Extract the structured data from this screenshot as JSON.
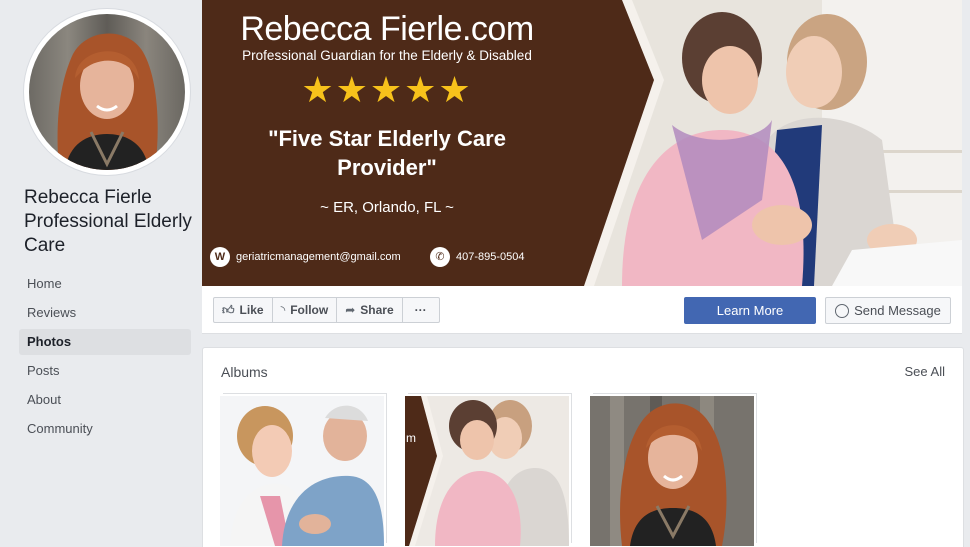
{
  "page": {
    "name": "Rebecca Fierle\nProfessional Elderly\nCare"
  },
  "nav": {
    "items": [
      {
        "label": "Home",
        "active": false
      },
      {
        "label": "Reviews",
        "active": false
      },
      {
        "label": "Photos",
        "active": true
      },
      {
        "label": "Posts",
        "active": false
      },
      {
        "label": "About",
        "active": false
      },
      {
        "label": "Community",
        "active": false
      }
    ]
  },
  "cover": {
    "title": "Rebecca Fierle.com",
    "subtitle": "Professional Guardian for the Elderly & Disabled",
    "stars": "★★★★★",
    "quote": "\"Five Star Elderly Care Provider\"",
    "location": "~ ER, Orlando, FL ~",
    "email": "geriatricmanagement@gmail.com",
    "phone": "407-895-0504",
    "colors": {
      "brown": "#4e2a18",
      "star": "#f7c21b"
    }
  },
  "actions": {
    "like": "Like",
    "follow": "Follow",
    "share": "Share",
    "more": "···",
    "learn_more": "Learn More",
    "send_message": "Send Message"
  },
  "albums": {
    "title": "Albums",
    "see_all": "See All"
  },
  "colors": {
    "accent": "#4267b2",
    "background": "#e9ebee"
  }
}
